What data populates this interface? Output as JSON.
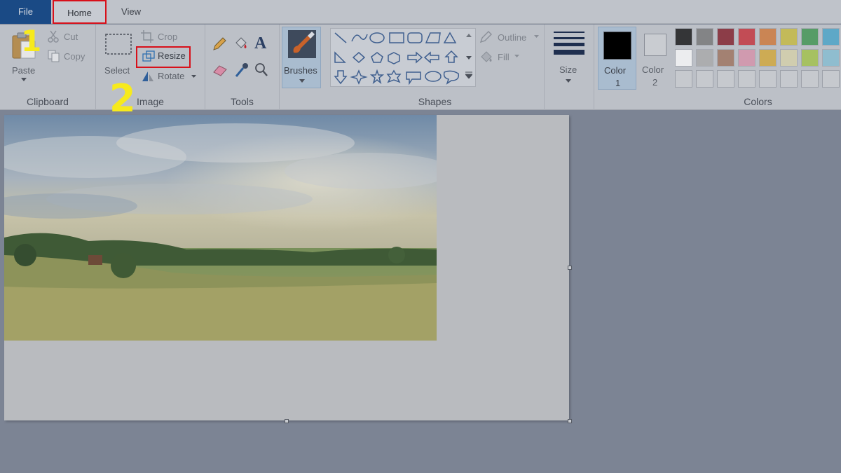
{
  "tabs": {
    "file": "File",
    "home": "Home",
    "view": "View"
  },
  "clipboard": {
    "paste": "Paste",
    "cut": "Cut",
    "copy": "Copy",
    "group": "Clipboard"
  },
  "image": {
    "select": "Select",
    "crop": "Crop",
    "resize": "Resize",
    "rotate": "Rotate",
    "group": "Image"
  },
  "tools": {
    "group": "Tools"
  },
  "brushes": {
    "label": "Brushes"
  },
  "shapes": {
    "outline": "Outline",
    "fill": "Fill",
    "group": "Shapes"
  },
  "size": {
    "label": "Size"
  },
  "colors": {
    "color1": "Color",
    "color1_num": "1",
    "color2": "Color",
    "color2_num": "2",
    "group": "Colors",
    "palette_row1": [
      "#000000",
      "#6e6e6e",
      "#7a0b18",
      "#c5202a",
      "#d06f28",
      "#c7b92f",
      "#2f8f43",
      "#3a9fc7"
    ],
    "palette_row2": [
      "#ffffff",
      "#a7a7a7",
      "#9a6a52",
      "#d88ca7",
      "#d4a329",
      "#d9d2a6",
      "#9ec23a",
      "#7fbcd3"
    ]
  },
  "annotations": {
    "step1": "1",
    "step2": "2"
  }
}
